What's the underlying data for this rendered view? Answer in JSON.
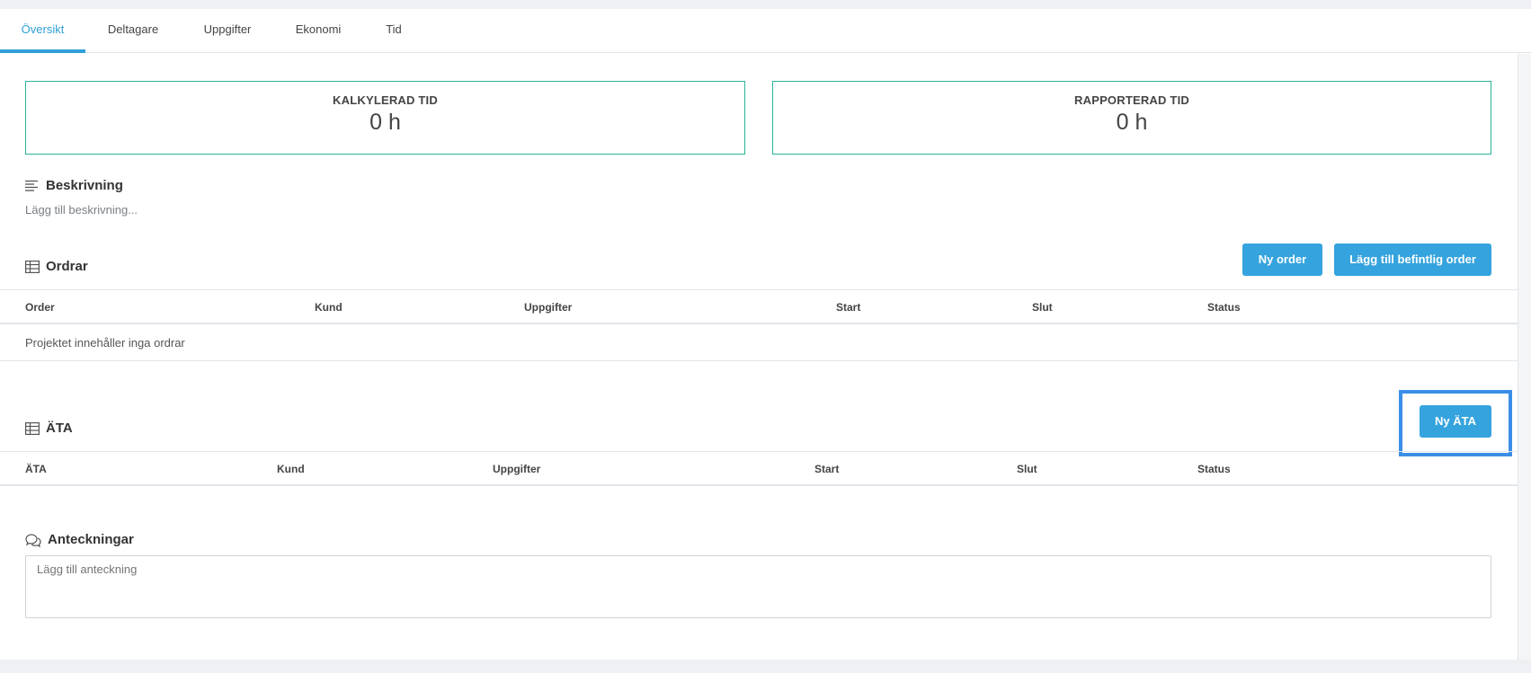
{
  "tabs": [
    {
      "label": "Översikt",
      "active": true
    },
    {
      "label": "Deltagare"
    },
    {
      "label": "Uppgifter"
    },
    {
      "label": "Ekonomi"
    },
    {
      "label": "Tid"
    }
  ],
  "stats": {
    "calculated": {
      "label": "KALKYLERAD TID",
      "value": "0 h"
    },
    "reported": {
      "label": "RAPPORTERAD TID",
      "value": "0 h"
    }
  },
  "description": {
    "title": "Beskrivning",
    "add_link": "Lägg till beskrivning...",
    "icon": "align-left-icon"
  },
  "orders": {
    "title": "Ordrar",
    "icon": "table-icon",
    "new_button": "Ny order",
    "add_existing_button": "Lägg till befintlig order",
    "columns": [
      "Order",
      "Kund",
      "Uppgifter",
      "Start",
      "Slut",
      "Status"
    ],
    "empty_text": "Projektet innehåller inga ordrar"
  },
  "ata": {
    "title": "ÄTA",
    "icon": "table-icon",
    "new_button": "Ny ÄTA",
    "columns": [
      "ÄTA",
      "Kund",
      "Uppgifter",
      "Start",
      "Slut",
      "Status"
    ]
  },
  "notes": {
    "title": "Anteckningar",
    "icon": "comments-icon",
    "placeholder": "Lägg till anteckning"
  },
  "colors": {
    "accent": "#35a3dd",
    "stat_border": "#2ab39a",
    "highlight": "#3b8ee6"
  }
}
